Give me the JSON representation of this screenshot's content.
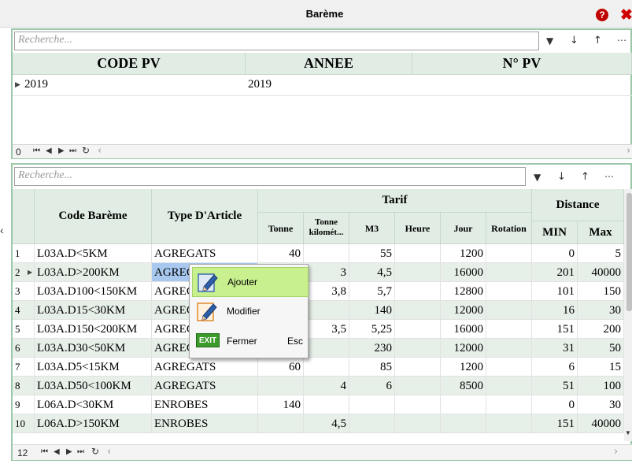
{
  "window": {
    "title": "Barème",
    "help_glyph": "?",
    "close_glyph": "✖"
  },
  "top": {
    "search_placeholder": "Recherche...",
    "columns": [
      "CODE PV",
      "ANNEE",
      "N° PV"
    ],
    "rows": [
      {
        "code_pv": "2019",
        "annee": "2019",
        "no_pv": ""
      }
    ],
    "record_count": "0"
  },
  "bottom": {
    "search_placeholder": "Recherche...",
    "headers": {
      "code": "Code Barème",
      "type": "Type D'Article",
      "tarif": "Tarif",
      "tonne": "Tonne",
      "tonne_km": "Tonne kilomét...",
      "m3": "M3",
      "heure": "Heure",
      "jour": "Jour",
      "rotation": "Rotation",
      "distance": "Distance",
      "min": "MIN",
      "max": "Max"
    },
    "rows": [
      {
        "idx": "1",
        "code": "L03A.D<5KM",
        "type": "AGREGATS",
        "tonne": "40",
        "tonne_km": "",
        "m3": "55",
        "heure": "",
        "jour": "1200",
        "rotation": "",
        "min": "0",
        "max": "5"
      },
      {
        "idx": "2",
        "code": "L03A.D>200KM",
        "type": "AGREGATS",
        "tonne": "",
        "tonne_km": "3",
        "m3": "4,5",
        "heure": "",
        "jour": "16000",
        "rotation": "",
        "min": "201",
        "max": "40000"
      },
      {
        "idx": "3",
        "code": "L03A.D100<150KM",
        "type": "AGREGATS",
        "tonne": "",
        "tonne_km": "3,8",
        "m3": "5,7",
        "heure": "",
        "jour": "12800",
        "rotation": "",
        "min": "101",
        "max": "150"
      },
      {
        "idx": "4",
        "code": "L03A.D15<30KM",
        "type": "AGREGATS",
        "tonne": "",
        "tonne_km": "",
        "m3": "140",
        "heure": "",
        "jour": "12000",
        "rotation": "",
        "min": "16",
        "max": "30"
      },
      {
        "idx": "5",
        "code": "L03A.D150<200KM",
        "type": "AGREGATS",
        "tonne": "",
        "tonne_km": "3,5",
        "m3": "5,25",
        "heure": "",
        "jour": "16000",
        "rotation": "",
        "min": "151",
        "max": "200"
      },
      {
        "idx": "6",
        "code": "L03A.D30<50KM",
        "type": "AGREGATS",
        "tonne": "",
        "tonne_km": "",
        "m3": "230",
        "heure": "",
        "jour": "12000",
        "rotation": "",
        "min": "31",
        "max": "50"
      },
      {
        "idx": "7",
        "code": "L03A.D5<15KM",
        "type": "AGREGATS",
        "tonne": "60",
        "tonne_km": "",
        "m3": "85",
        "heure": "",
        "jour": "1200",
        "rotation": "",
        "min": "6",
        "max": "15"
      },
      {
        "idx": "8",
        "code": "L03A.D50<100KM",
        "type": "AGREGATS",
        "tonne": "",
        "tonne_km": "4",
        "m3": "6",
        "heure": "",
        "jour": "8500",
        "rotation": "",
        "min": "51",
        "max": "100"
      },
      {
        "idx": "9",
        "code": "L06A.D<30KM",
        "type": "ENROBES",
        "tonne": "140",
        "tonne_km": "",
        "m3": "",
        "heure": "",
        "jour": "",
        "rotation": "",
        "min": "0",
        "max": "30"
      },
      {
        "idx": "10",
        "code": "L06A.D>150KM",
        "type": "ENROBES",
        "tonne": "",
        "tonne_km": "4,5",
        "m3": "",
        "heure": "",
        "jour": "",
        "rotation": "",
        "min": "151",
        "max": "40000"
      }
    ],
    "record_count": "12"
  },
  "context_menu": {
    "items": [
      {
        "label": "Ajouter",
        "shortcut": "",
        "icon": "pen-add-icon"
      },
      {
        "label": "Modifier",
        "shortcut": "",
        "icon": "pen-edit-icon"
      },
      {
        "label": "Fermer",
        "shortcut": "Esc",
        "icon": "exit-icon"
      }
    ],
    "exit_glyph": "EXIT"
  },
  "colors": {
    "accent_green": "#9cc8a9",
    "header_bg": "#e1ede4",
    "menu_highlight": "#c8f08e",
    "close_red": "#d00000"
  }
}
